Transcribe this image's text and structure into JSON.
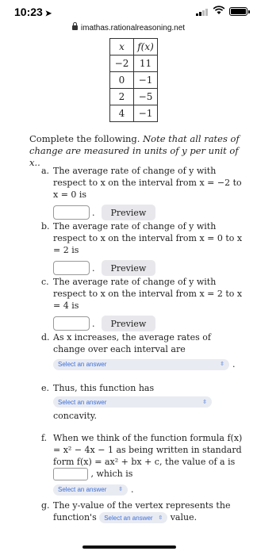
{
  "status": {
    "time": "10:23"
  },
  "url": "imathas.rationalreasoning.net",
  "table": {
    "headers": [
      "x",
      "f(x)"
    ],
    "rows": [
      [
        "−2",
        "11"
      ],
      [
        "0",
        "−1"
      ],
      [
        "2",
        "−5"
      ],
      [
        "4",
        "−1"
      ]
    ]
  },
  "intro": {
    "text": "Complete the following.",
    "note": "Note that all rates of change are measured in units of y per unit of x.."
  },
  "questions": {
    "a": {
      "letter": "a.",
      "text": "The average rate of change of y with respect to x on the interval from x = −2 to x = 0 is",
      "preview": "Preview"
    },
    "b": {
      "letter": "b.",
      "text": "The average rate of change of y with respect to x on the interval from x = 0 to x = 2 is",
      "preview": "Preview"
    },
    "c": {
      "letter": "c.",
      "text": "The average rate of change of y with respect to x on the interval from x = 2 to x = 4 is",
      "preview": "Preview"
    },
    "d": {
      "letter": "d.",
      "text": "As x increases, the average rates of change over each interval are",
      "select": "Select an answer"
    },
    "e": {
      "letter": "e.",
      "text": "Thus, this function has",
      "select": "Select an answer",
      "after": "concavity."
    },
    "f": {
      "letter": "f.",
      "text1": "When we think of the function formula f(x) = x² − 4x − 1 as being written in standard form f(x) = ax² + bx + c, the value of a is",
      "text2": ", which is",
      "select": "Select an answer"
    },
    "g": {
      "letter": "g.",
      "text1": "The y-value of the vertex represents the function's",
      "select": "Select an answer",
      "text2": "value."
    }
  }
}
